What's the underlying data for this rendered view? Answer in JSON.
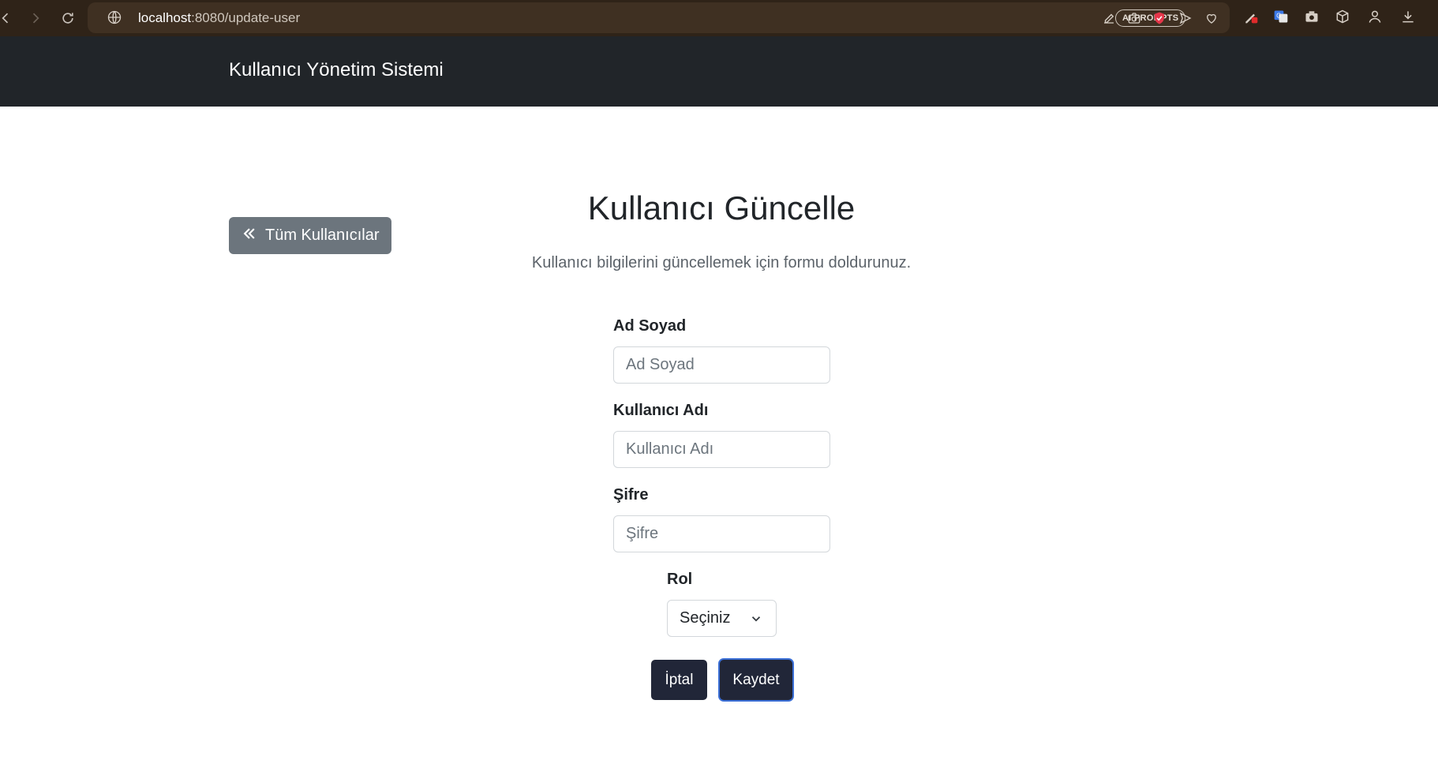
{
  "browser": {
    "url_host": "localhost",
    "url_rest": ":8080/update-user",
    "ai_prompts_label": "AI PROMPTS"
  },
  "navbar": {
    "brand": "Kullanıcı Yönetim Sistemi"
  },
  "back_button": {
    "label": "Tüm Kullanıcılar"
  },
  "page": {
    "title": "Kullanıcı Güncelle",
    "subtitle": "Kullanıcı bilgilerini güncellemek için formu doldurunuz."
  },
  "form": {
    "fullname": {
      "label": "Ad Soyad",
      "placeholder": "Ad Soyad",
      "value": ""
    },
    "username": {
      "label": "Kullanıcı Adı",
      "placeholder": "Kullanıcı Adı",
      "value": ""
    },
    "password": {
      "label": "Şifre",
      "placeholder": "Şifre",
      "value": ""
    },
    "role": {
      "label": "Rol",
      "selected": "Seçiniz"
    },
    "cancel_label": "İptal",
    "save_label": "Kaydet"
  },
  "colors": {
    "navbar_bg": "#212529",
    "secondary_button": "#6c757d",
    "dark_button": "#212638",
    "focus_ring": "#3b6fd6"
  }
}
